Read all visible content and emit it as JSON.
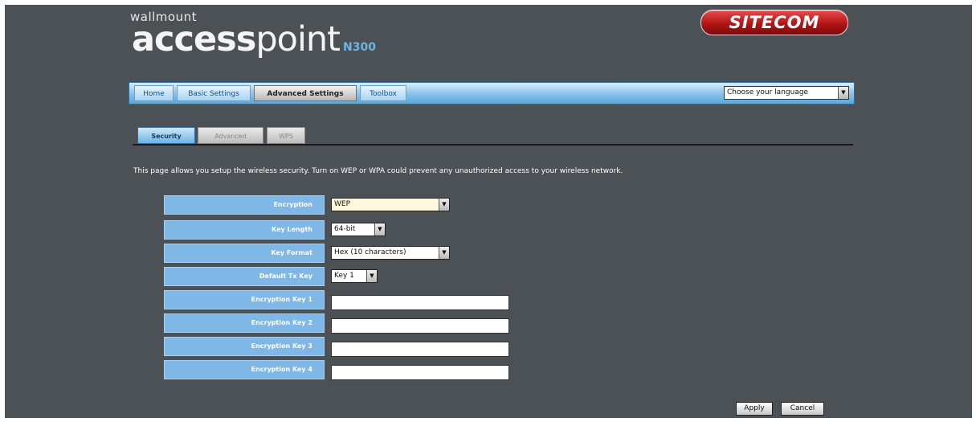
{
  "branding": {
    "small": "wallmount",
    "big_bold": "access",
    "big_regular": "point",
    "model": "N300",
    "logo": "SITECOM"
  },
  "nav": {
    "items": [
      {
        "label": "Home",
        "active": false
      },
      {
        "label": "Basic Settings",
        "active": false
      },
      {
        "label": "Advanced Settings",
        "active": true
      },
      {
        "label": "Toolbox",
        "active": false
      }
    ],
    "language": "Choose your language"
  },
  "subtabs": [
    {
      "label": "Security",
      "active": true
    },
    {
      "label": "Advanced",
      "active": false
    },
    {
      "label": "WPS",
      "active": false
    }
  ],
  "description": "This page allows you setup the wireless security. Turn on WEP or WPA could prevent any unauthorized access to your wireless network.",
  "form": {
    "encryption": {
      "label": "Encryption",
      "value": "WEP"
    },
    "key_length": {
      "label": "Key Length",
      "value": "64-bit"
    },
    "key_format": {
      "label": "Key Format",
      "value": "Hex (10 characters)"
    },
    "default_tx_key": {
      "label": "Default Tx Key",
      "value": "Key 1"
    },
    "keys": [
      {
        "label": "Encryption Key 1",
        "value": ""
      },
      {
        "label": "Encryption Key 2",
        "value": ""
      },
      {
        "label": "Encryption Key 3",
        "value": ""
      },
      {
        "label": "Encryption Key 4",
        "value": ""
      }
    ]
  },
  "buttons": {
    "apply": "Apply",
    "cancel": "Cancel"
  },
  "colors": {
    "background": "#4c5155",
    "nav_blue": "#8cc4ec",
    "label_blue": "#7fb8e6",
    "logo_red": "#b31515"
  }
}
